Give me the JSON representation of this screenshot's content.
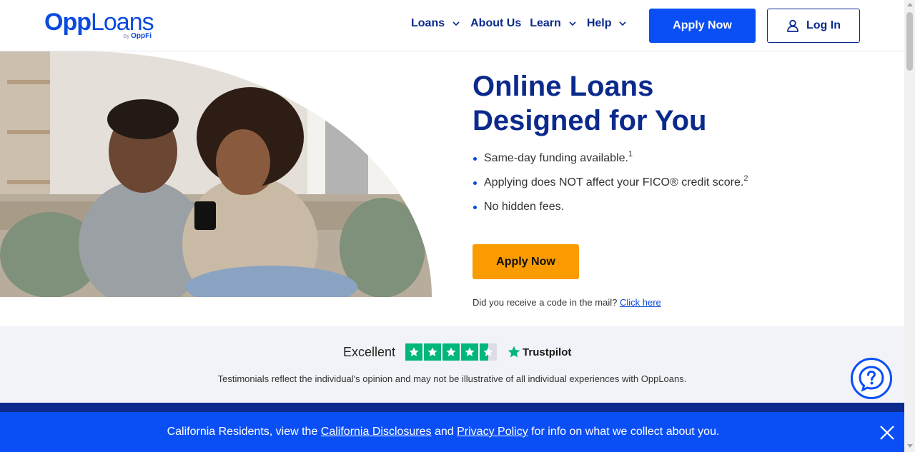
{
  "header": {
    "logo_main_bold": "Opp",
    "logo_main_light": "Loans",
    "logo_by": "by",
    "logo_sub": "OppFi",
    "nav": {
      "loans": "Loans",
      "about": "About Us",
      "learn": "Learn",
      "help": "Help"
    },
    "apply_label": "Apply Now",
    "login_label": "Log In"
  },
  "hero": {
    "title": "Online Loans Designed for You",
    "bullets": [
      {
        "text": "Same-day funding available.",
        "sup": "1"
      },
      {
        "text": "Applying does NOT affect your FICO® credit score.",
        "sup": "2"
      },
      {
        "text": "No hidden fees.",
        "sup": ""
      }
    ],
    "apply_label": "Apply Now",
    "mail_prompt": "Did you receive a code in the mail?",
    "mail_link": "Click here"
  },
  "trust": {
    "rating_word": "Excellent",
    "stars": 4.5,
    "brand": "Trustpilot",
    "testimonial_note": "Testimonials reflect the individual's opinion and may not be illustrative of all individual experiences with OppLoans."
  },
  "ca_banner": {
    "prefix": "California Residents, view the",
    "disclosures_link": "California Disclosures",
    "and": "and",
    "privacy_link": "Privacy Policy",
    "suffix": "for info on what we collect about you."
  },
  "colors": {
    "brand_blue": "#0a4ff5",
    "navy": "#0b2a8c",
    "orange": "#fa9b00",
    "trustpilot_green": "#00b67a"
  },
  "icons": {
    "chevron": "chevron-down-icon",
    "login": "user-icon",
    "chat": "help-chat-icon",
    "close": "close-icon",
    "star": "star-icon"
  }
}
